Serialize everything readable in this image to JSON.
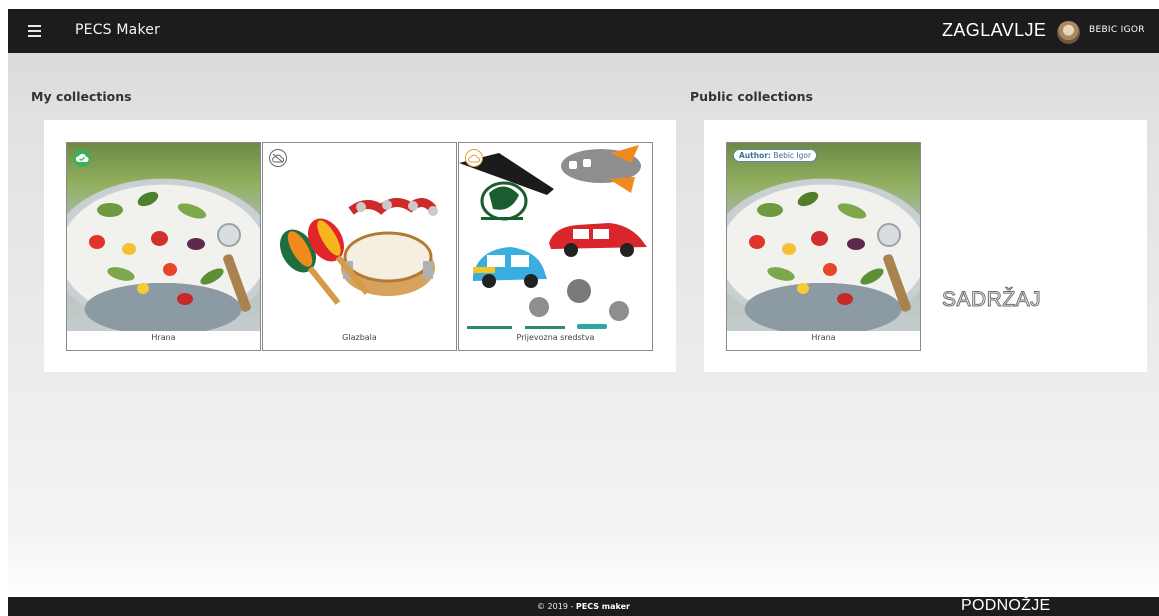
{
  "header": {
    "app_title": "PECS Maker",
    "label": "ZAGLAVLJE",
    "user_name": "BEBIC IGOR",
    "menu_icon": "hamburger-menu-icon",
    "background": "#1c1c1c"
  },
  "my_collections": {
    "title": "My collections",
    "items": [
      {
        "caption": "Hrana",
        "cloud_icon": "cloud-check-icon",
        "cloud_color": "#3cae5a"
      },
      {
        "caption": "Glazbala",
        "cloud_icon": "cloud-off-icon",
        "cloud_color": "#666666"
      },
      {
        "caption": "Prijevozna sredstva",
        "cloud_icon": "cloud-icon",
        "cloud_color": "#e0a13e"
      }
    ]
  },
  "public_collections": {
    "title": "Public collections",
    "items": [
      {
        "caption": "Hrana",
        "author_label": "Author:",
        "author_name": "Bebic Igor"
      }
    ],
    "content_label": "SADRŽAJ"
  },
  "footer": {
    "copyright_prefix": "© 2019 - ",
    "copyright_brand": "PECS maker",
    "label": "PODNOŽJE",
    "background": "#1c1c1c"
  }
}
